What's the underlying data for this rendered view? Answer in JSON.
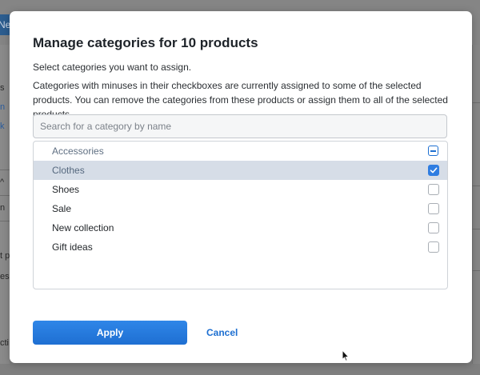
{
  "background": {
    "new_button_label": "Ne",
    "left_fragments": [
      "s",
      "n",
      "k",
      "^",
      "n",
      "t p",
      "es",
      "cti"
    ]
  },
  "dialog": {
    "title": "Manage categories for 10 products",
    "subtitle": "Select categories you want to assign.",
    "description": "Categories with minuses in their checkboxes are currently assigned to some of the selected products. You can remove the categories from these products or assign them to all of the selected products.",
    "search": {
      "value": "",
      "placeholder": "Search for a category by name"
    },
    "categories": [
      {
        "label": "Accessories",
        "state": "indeterminate"
      },
      {
        "label": "Clothes",
        "state": "checked",
        "highlighted": true
      },
      {
        "label": "Shoes",
        "state": "unchecked"
      },
      {
        "label": "Sale",
        "state": "unchecked"
      },
      {
        "label": "New collection",
        "state": "unchecked"
      },
      {
        "label": "Gift ideas",
        "state": "unchecked"
      }
    ],
    "apply_label": "Apply",
    "cancel_label": "Cancel"
  },
  "colors": {
    "accent": "#2f7de1",
    "link": "#1d6fd1",
    "highlight_row": "#d6dde7",
    "overlay": "#808080"
  },
  "icons": {
    "checked": "checkmark-icon",
    "indeterminate": "minus-icon",
    "cursor": "mouse-pointer-icon"
  }
}
